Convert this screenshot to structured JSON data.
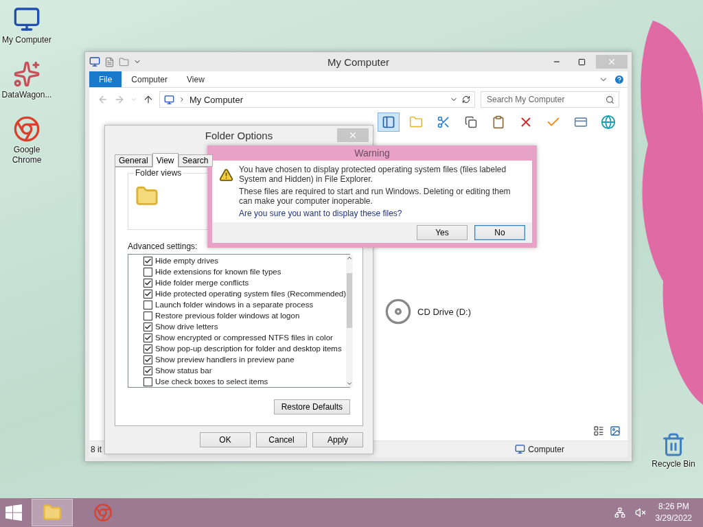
{
  "desktop_icons": [
    {
      "label": "My Computer",
      "kind": "computer"
    },
    {
      "label": "DataWagon...",
      "kind": "app"
    },
    {
      "label": "Google Chrome",
      "kind": "browser"
    },
    {
      "label": "Recycle Bin",
      "kind": "recycle"
    }
  ],
  "explorer": {
    "title": "My Computer",
    "ribbon_tabs": [
      {
        "label": "File",
        "highlighted": true
      },
      {
        "label": "Computer",
        "highlighted": false
      },
      {
        "label": "View",
        "highlighted": false
      }
    ],
    "address": "My Computer",
    "search": {
      "placeholder": "Search My Computer"
    },
    "items": [
      {
        "label": "CD Drive (D:)"
      }
    ],
    "status_left": "8 it",
    "status_right": "Computer"
  },
  "folder_options": {
    "title": "Folder Options",
    "tabs": [
      {
        "label": "General",
        "selected": false
      },
      {
        "label": "View",
        "selected": true
      },
      {
        "label": "Search",
        "selected": false
      }
    ],
    "group_label": "Folder views",
    "advanced_label": "Advanced settings:",
    "settings": [
      {
        "label": "Hide empty drives",
        "checked": true
      },
      {
        "label": "Hide extensions for known file types",
        "checked": false
      },
      {
        "label": "Hide folder merge conflicts",
        "checked": true
      },
      {
        "label": "Hide protected operating system files (Recommended)",
        "checked": true
      },
      {
        "label": "Launch folder windows in a separate process",
        "checked": false
      },
      {
        "label": "Restore previous folder windows at logon",
        "checked": false
      },
      {
        "label": "Show drive letters",
        "checked": true
      },
      {
        "label": "Show encrypted or compressed NTFS files in color",
        "checked": true
      },
      {
        "label": "Show pop-up description for folder and desktop items",
        "checked": true
      },
      {
        "label": "Show preview handlers in preview pane",
        "checked": true
      },
      {
        "label": "Show status bar",
        "checked": true
      },
      {
        "label": "Use check boxes to select items",
        "checked": false
      }
    ],
    "restore": "Restore Defaults",
    "buttons": [
      "OK",
      "Cancel",
      "Apply"
    ]
  },
  "warning": {
    "title": "Warning",
    "messages": [
      "You have chosen to display protected operating system files (files labeled System and Hidden) in File Explorer.",
      "These files are required to start and run Windows. Deleting or editing them can make your computer inoperable."
    ],
    "question": "Are you sure you want to display these files?",
    "buttons": [
      {
        "label": "Yes",
        "default": false
      },
      {
        "label": "No",
        "default": true
      }
    ]
  },
  "taskbar": {
    "apps": [
      {
        "kind": "explorer",
        "selected": true
      },
      {
        "kind": "browser",
        "selected": false
      }
    ],
    "time": "8:26 PM",
    "date": "3/29/2022"
  }
}
